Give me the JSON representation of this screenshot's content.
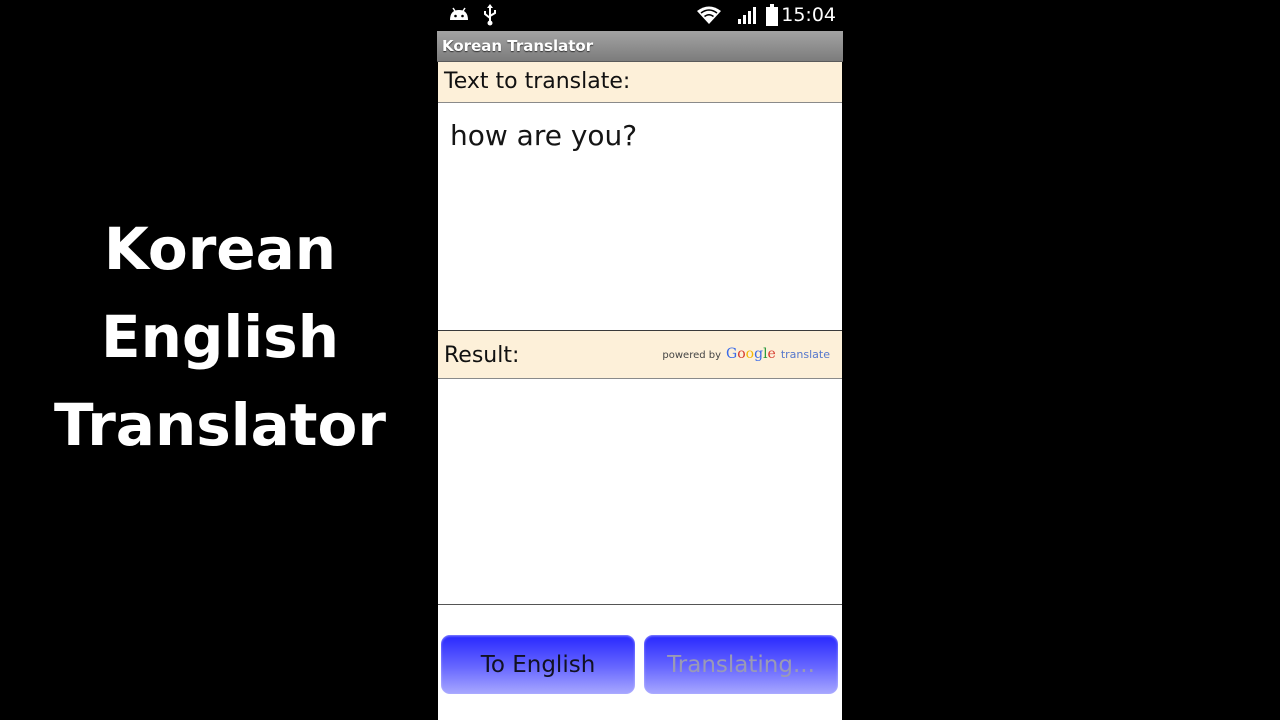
{
  "overlay": {
    "title_lines": [
      "Korean",
      "English",
      "Translator"
    ]
  },
  "status_bar": {
    "time": "15:04",
    "icons": [
      "android-icon",
      "usb-icon",
      "wifi-icon",
      "signal-icon",
      "battery-icon"
    ]
  },
  "app": {
    "title": "Korean Translator"
  },
  "input_section": {
    "header": "Text to translate:",
    "value": "how are you?"
  },
  "result_section": {
    "header": "Result:",
    "powered_by": "powered by",
    "brand": "Google",
    "brand_suffix": "translate",
    "value": ""
  },
  "buttons": {
    "to_english": "To English",
    "translate": "Translating..."
  },
  "colors": {
    "header_bg": "#fdf0d9",
    "button_blue": "#4a4aff",
    "google": [
      "#3b6be8",
      "#d63b2f",
      "#f2b70a",
      "#3b6be8",
      "#2a9a3e",
      "#d63b2f"
    ]
  }
}
